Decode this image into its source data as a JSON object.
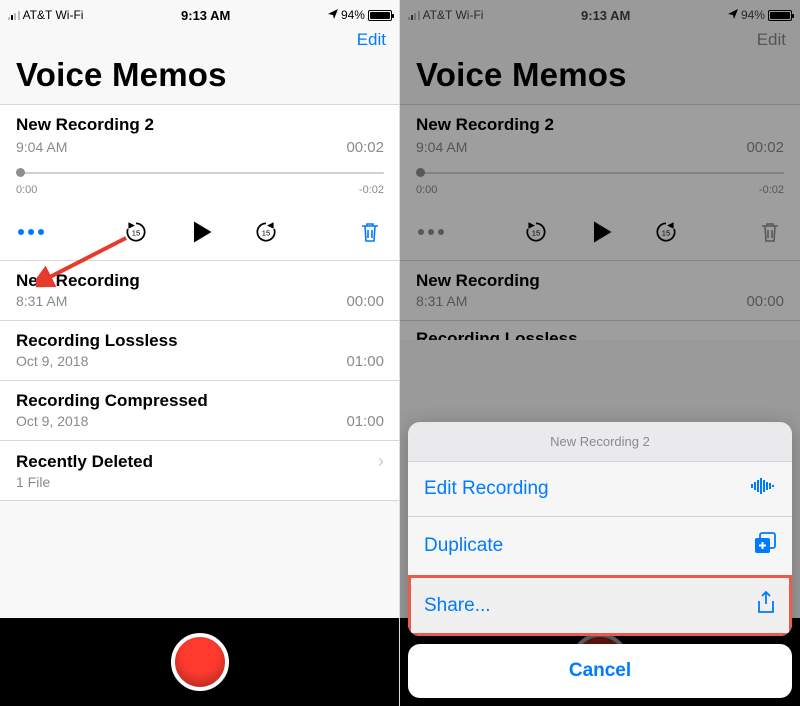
{
  "status": {
    "carrier": "AT&T Wi-Fi",
    "time": "9:13 AM",
    "battery_pct": "94%",
    "battery_fill_pct": 94
  },
  "nav": {
    "edit": "Edit"
  },
  "title": "Voice Memos",
  "current": {
    "name": "New Recording 2",
    "time": "9:04 AM",
    "duration": "00:02",
    "elapsed": "0:00",
    "remaining": "-0:02"
  },
  "items": [
    {
      "name": "New Recording",
      "sub": "8:31 AM",
      "dur": "00:00"
    },
    {
      "name": "Recording Lossless",
      "sub": "Oct 9, 2018",
      "dur": "01:00"
    },
    {
      "name": "Recording Compressed",
      "sub": "Oct 9, 2018",
      "dur": "01:00"
    }
  ],
  "recently_deleted": {
    "label": "Recently Deleted",
    "sub": "1 File"
  },
  "sheet": {
    "title": "New Recording 2",
    "edit": "Edit Recording",
    "duplicate": "Duplicate",
    "share": "Share...",
    "cancel": "Cancel"
  },
  "phone2_items": [
    {
      "name": "New Recording",
      "sub": "8:31 AM",
      "dur": "00:00"
    }
  ],
  "phone2_lossless_label": "Recording Lossless",
  "colors": {
    "accent": "#007aff",
    "destructive": "#ff3b30"
  }
}
